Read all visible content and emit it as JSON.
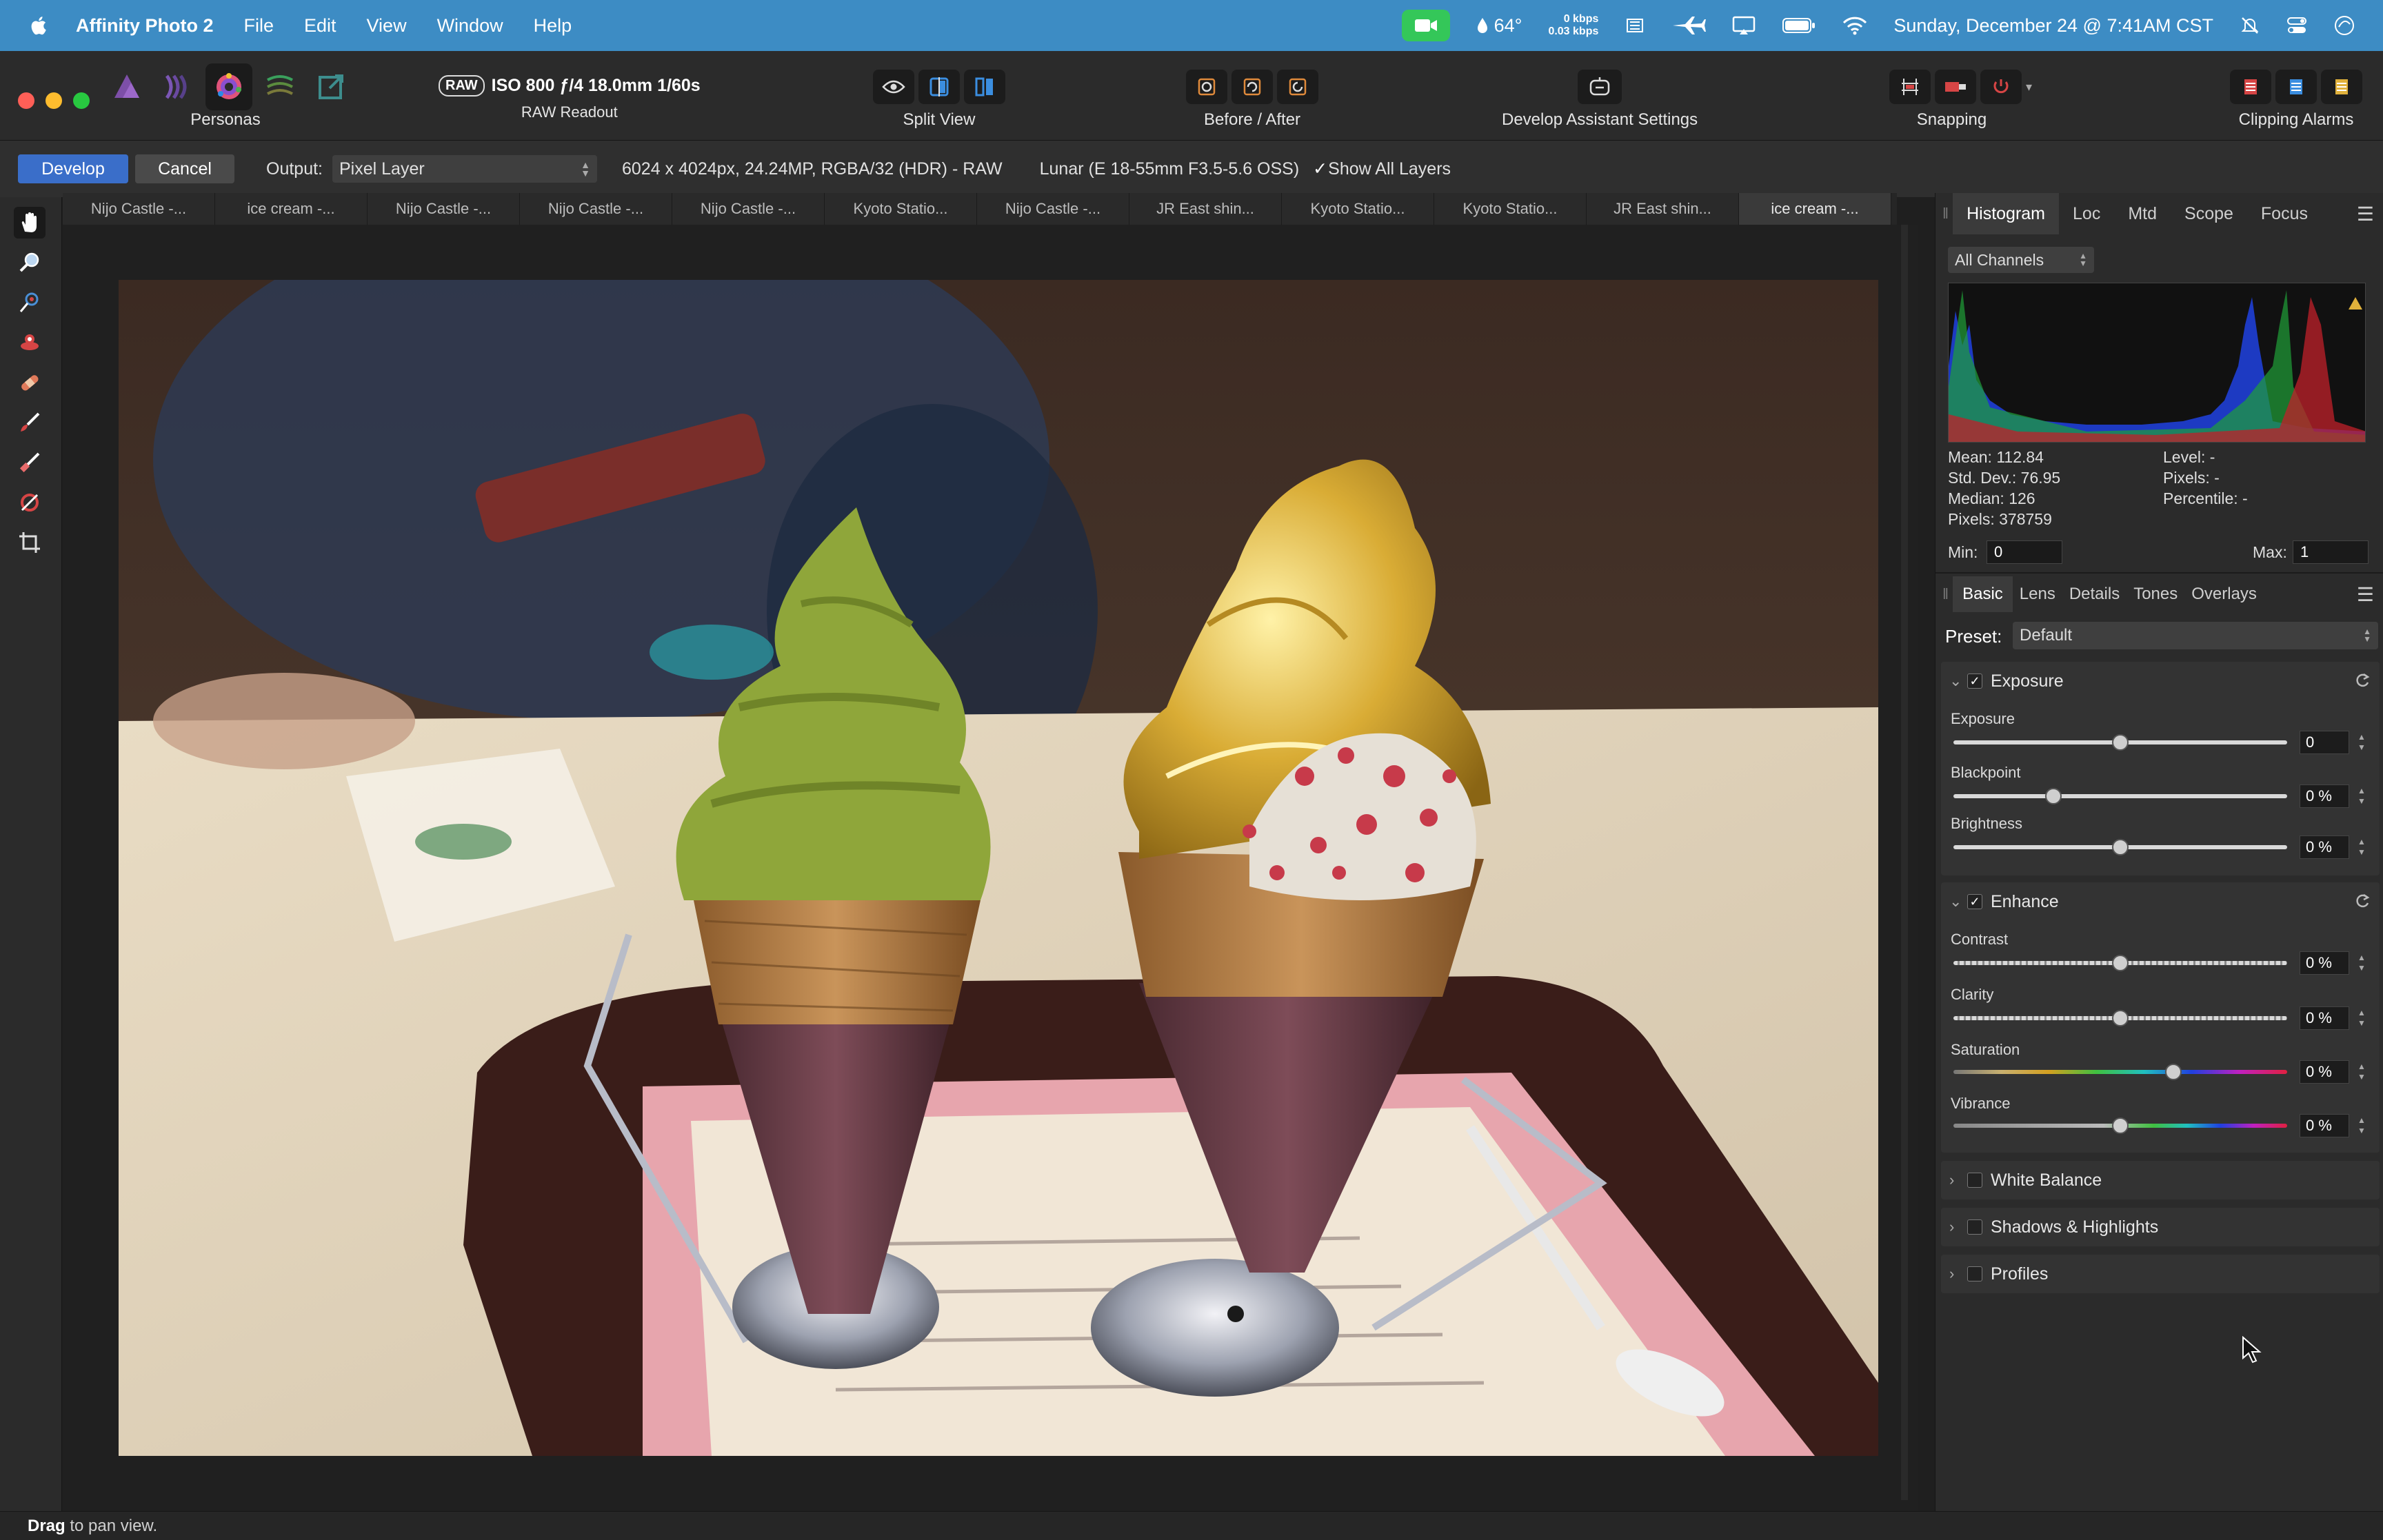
{
  "menubar": {
    "app_name": "Affinity Photo 2",
    "menus": [
      "File",
      "Edit",
      "View",
      "Window",
      "Help"
    ],
    "temperature": "64°",
    "net_up": "0 kbps",
    "net_down": "0.03 kbps",
    "datetime": "Sunday, December 24 @ 7:41AM CST"
  },
  "toolbar": {
    "personas_label": "Personas",
    "raw_badge": "RAW",
    "raw_info": "ISO 800 ƒ/4 18.0mm 1/60s",
    "raw_readout_label": "RAW Readout",
    "split_view_label": "Split View",
    "before_after_label": "Before / After",
    "develop_assistant_label": "Develop Assistant Settings",
    "snapping_label": "Snapping",
    "clipping_alarms_label": "Clipping Alarms"
  },
  "contextbar": {
    "develop": "Develop",
    "cancel": "Cancel",
    "output_label": "Output:",
    "output_value": "Pixel Layer",
    "image_info": "6024 x 4024px, 24.24MP, RGBA/32 (HDR) - RAW",
    "lens_info": "Lunar (E 18-55mm F3.5-5.6 OSS)",
    "show_all_layers": "Show All Layers"
  },
  "tabs": [
    {
      "label": "Nijo Castle -..."
    },
    {
      "label": "ice cream -..."
    },
    {
      "label": "Nijo Castle -..."
    },
    {
      "label": "Nijo Castle -..."
    },
    {
      "label": "Nijo Castle -..."
    },
    {
      "label": "Kyoto Statio..."
    },
    {
      "label": "Nijo Castle -..."
    },
    {
      "label": "JR East shin..."
    },
    {
      "label": "Kyoto Statio..."
    },
    {
      "label": "Kyoto Statio..."
    },
    {
      "label": "JR East shin..."
    },
    {
      "label": "ice cream -..."
    }
  ],
  "status": {
    "bold": "Drag",
    "rest": " to pan view."
  },
  "histogram": {
    "tabs": [
      "Histogram",
      "Loc",
      "Mtd",
      "Scope",
      "Focus"
    ],
    "channel": "All Channels",
    "mean": "Mean: 112.84",
    "std": "Std. Dev.: 76.95",
    "median": "Median: 126",
    "pixels": "Pixels: 378759",
    "level": "Level: -",
    "pixels_r": "Pixels: -",
    "percentile": "Percentile: -",
    "min_label": "Min:",
    "min_value": "0",
    "max_label": "Max:",
    "max_value": "1"
  },
  "develop_panel": {
    "tabs": [
      "Basic",
      "Lens",
      "Details",
      "Tones",
      "Overlays"
    ],
    "preset_label": "Preset:",
    "preset_value": "Default",
    "exposure": {
      "title": "Exposure",
      "sliders": [
        {
          "label": "Exposure",
          "value": "0",
          "level": 0.5
        },
        {
          "label": "Blackpoint",
          "value": "0 %",
          "level": 0.3
        },
        {
          "label": "Brightness",
          "value": "0 %",
          "level": 0.5
        }
      ]
    },
    "enhance": {
      "title": "Enhance",
      "sliders": [
        {
          "label": "Contrast",
          "value": "0 %",
          "level": 0.5
        },
        {
          "label": "Clarity",
          "value": "0 %",
          "level": 0.5
        },
        {
          "label": "Saturation",
          "value": "0 %",
          "level": 0.66
        },
        {
          "label": "Vibrance",
          "value": "0 %",
          "level": 0.5
        }
      ]
    },
    "collapsed": [
      "White Balance",
      "Shadows & Highlights",
      "Profiles"
    ]
  }
}
